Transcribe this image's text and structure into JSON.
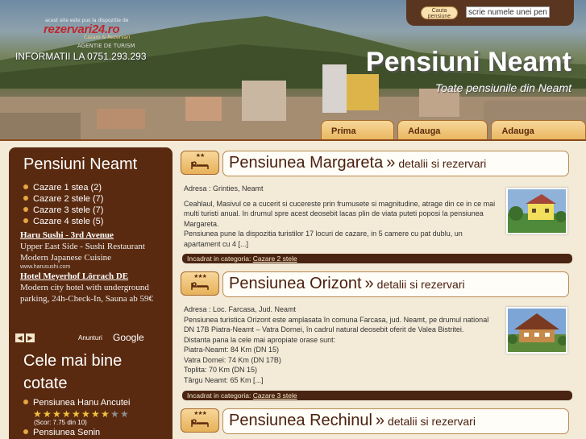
{
  "header": {
    "logo_small": "acest site este pus la dispozitie de",
    "logo_main": "rezervari24.ro",
    "logo_sub": "Cazare & Rezervari",
    "logo_agency": "AGENTIE DE TURISM",
    "info": "INFORMATII LA 0751.293.293",
    "search_button": "Cauta pensiune",
    "search_value": "scrie numele unei pensiuni",
    "site_title": "Pensiuni Neamt",
    "site_subtitle": "Toate pensiunile din Neamt",
    "tabs": [
      "Prima pagina",
      "Adauga pensiune",
      "Adauga restaurant"
    ]
  },
  "sidebar": {
    "title": "Pensiuni Neamt",
    "items": [
      "Cazare 1 stea (2)",
      "Cazare 2 stele (7)",
      "Cazare 3 stele (7)",
      "Cazare 4 stele (5)"
    ],
    "ads": [
      {
        "title": "Haru Sushi - 3rd Avenue",
        "text": "Upper East Side - Sushi Restaurant Modern Japanese Cuisine",
        "url": "www.harusushi.com"
      },
      {
        "title": "Hotel Meyerhof Lörrach DE",
        "text": "Modern city hotel with underground parking, 24h-Check-In, Sauna ab 59€",
        "url": ""
      }
    ],
    "ads_label": "Anunturi",
    "ads_brand": "Google",
    "best_title": "Cele mai bine cotate",
    "best_items": [
      {
        "name": "Pensiunea Hanu Ancutei",
        "score": "(Scor: 7.75 din 10)",
        "rating": 7.75
      },
      {
        "name": "Pensiunea Senin"
      }
    ]
  },
  "entries": [
    {
      "stars": "★★",
      "name": "Pensiunea Margareta",
      "link": "detalii si rezervari",
      "body": [
        "Adresa : Grinties, Neamt",
        "",
        "Ceahlaul, Masivul ce a cucerit si cucereste prin frumusete si magnitudine, atrage din ce in ce mai multi turisti anual. In drumul spre acest deosebit lacas plin de viata puteti poposi la pensiunea Margareta.",
        "Pensiunea pune la dispozitia turistilor 17 locuri de cazare, in 5 camere cu pat dublu, un apartament cu 4 [...]"
      ],
      "category_label": "Incadrat in categoria:",
      "category": "Cazare 2 stele"
    },
    {
      "stars": "★★★",
      "name": "Pensiunea Orizont",
      "link": "detalii si rezervari",
      "body": [
        "Adresa : Loc. Farcasa, Jud. Neamt",
        "Pensiunea turistica Orizont este amplasata în comuna Farcasa, jud. Neamt, pe drumul national DN 17B Piatra-Neamt – Vatra Dornei, în cadrul natural deosebit oferit de Valea Bistritei.",
        "Distanta pana la cele mai apropiate orase sunt:",
        "Piatra-Neamt: 84 Km (DN 15)",
        "Vatra Dornei: 74 Km (DN 17B)",
        "Toplita: 70 Km (DN 15)",
        "Târgu Neamt: 65 Km [...]"
      ],
      "category_label": "Incadrat in categoria:",
      "category": "Cazare 3 stele"
    },
    {
      "stars": "★★★",
      "name": "Pensiunea Rechinul",
      "link": "detalii si rezervari"
    }
  ]
}
